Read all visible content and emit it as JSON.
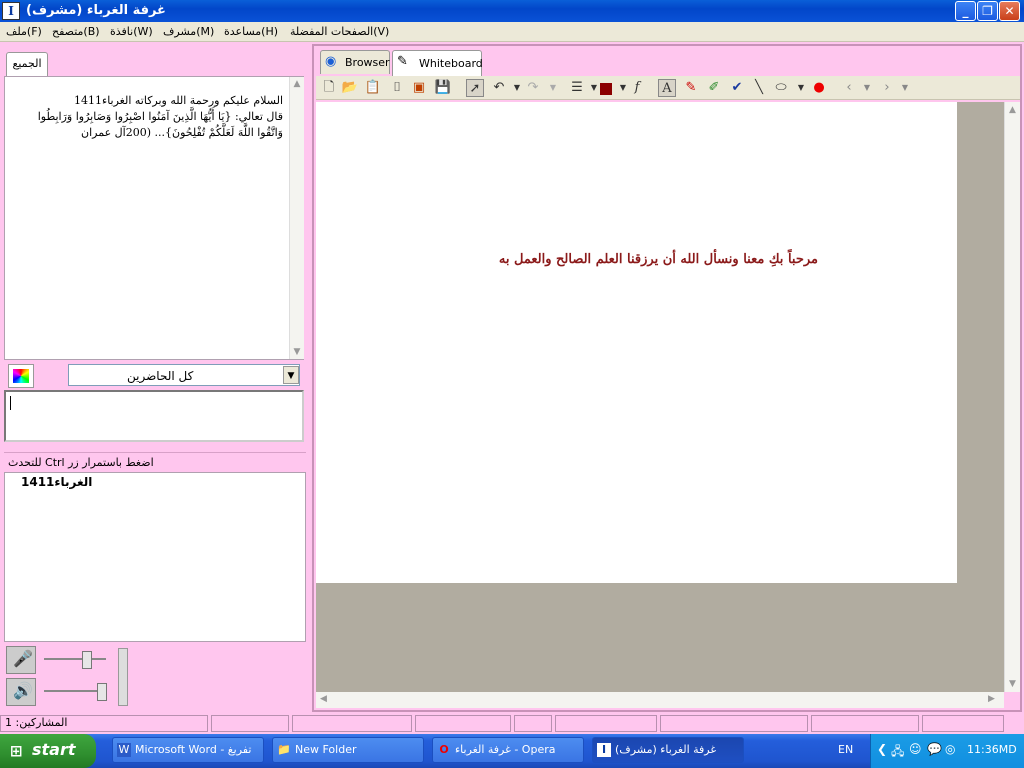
{
  "window": {
    "title": "غرفة الغرباء (مشرف)",
    "app_icon": "I",
    "minimize_icon": "minimize-icon",
    "maximize_icon": "restore-icon",
    "close_icon": "close-icon"
  },
  "menu": [
    "الصفحات المفضلة(V)",
    "مساعدة(H)",
    "مشرف(M)",
    "نافذة(W)",
    "متصفح(B)",
    "ملف(F)"
  ],
  "chat": {
    "tab": "الجميع",
    "lines": [
      "السلام عليكم ورحمة الله وبركاته  الغرباء1411",
      "قال تعالي: {يَا أَيُّهَا الَّذِينَ آمَنُوا اصْبِرُوا وَصَابِرُوا وَرَابِطُوا",
      "وَاتَّقُوا اللَّهَ لَعَلَّكُمْ تُفْلِحُونَ}... (200آل عمران"
    ],
    "recipient": "كل الحاضرين"
  },
  "users": {
    "header": "للتحدث Ctrl اضغط باستمرار زر",
    "list": [
      "الغرباء1411"
    ]
  },
  "whiteboard": {
    "tabs": [
      "Browser",
      "Whiteboard"
    ],
    "message": "مرحباً بكِ معنا ونسأل الله أن يرزقنا العلم الصالح والعمل به",
    "message_color": "#8b1a1a",
    "pen_color": "#8b0000"
  },
  "status": {
    "participants": "المشاركين: 1"
  },
  "taskbar": {
    "start": "start",
    "tasks": [
      "Microsoft Word - تفريغ",
      "New Folder",
      "غرفة الغرباء - Opera",
      "غرفة الغرباء (مشرف)"
    ],
    "lang": "EN",
    "clock": "11:36MD"
  }
}
